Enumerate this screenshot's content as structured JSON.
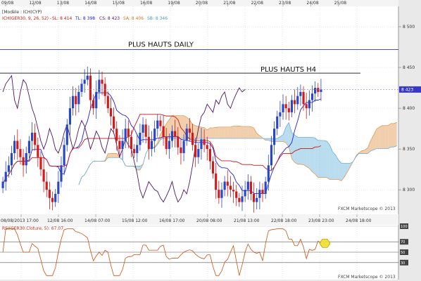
{
  "header": {
    "modele": "[Modèle : ICH(CYP)",
    "ichimoku_name": "ICH(GER30, 9, 26, 52) -",
    "sl": "SL: 8 414",
    "tl": "TL: 8 398",
    "cs": "CS: 8 423",
    "sa": "SA: 8 406",
    "sb": "SB: 8 346"
  },
  "top_dates": [
    "09/08",
    "12/08",
    "13/08",
    "14/08",
    "15/08",
    "16/08",
    "19/08",
    "20/08",
    "21/08",
    "22/08",
    "23/08",
    "24/08",
    "25/08"
  ],
  "bottom_dates": [
    "08/08/2013 17:00",
    "12/08 16:00",
    "14/08 07:00",
    "15/08 12:00",
    "16/08 17:00",
    "20/08 08:00",
    "21/08 13:00",
    "22/08 18:00",
    "23/08 23:00",
    "24/08 18:00"
  ],
  "price_axis": {
    "ticks": [
      "8 500",
      "8 450",
      "8 400",
      "8 350",
      "8 300"
    ],
    "current": "8 423"
  },
  "annotations": {
    "daily": "PLUS HAUTS DAILY",
    "h4": "PLUS HAUTS H4"
  },
  "watermark": "FXCM Marketscope © 2013",
  "rsi": {
    "label": "RSI(GER30.Cloture, 5): 67.07",
    "ticks": [
      "100",
      "70",
      "50",
      "30"
    ]
  },
  "colors": {
    "bull": "#2746c8",
    "bear": "#d21a1a",
    "tenkan": "#2020d8",
    "kijun": "#c81818",
    "chikou": "#4a1860",
    "senkou_a": "#e8a868",
    "senkou_b": "#80c0e0",
    "rsi": "#d05010",
    "highlight": "#f0e040"
  },
  "chart_data": [
    {
      "type": "candlestick",
      "title": "",
      "ylim": [
        8270,
        8525
      ],
      "x_ticks": [
        "08/08/2013 17:00",
        "12/08 16:00",
        "14/08 07:00",
        "15/08 12:00",
        "16/08 17:00",
        "20/08 08:00",
        "21/08 13:00",
        "22/08 18:00",
        "23/08 23:00",
        "24/08 18:00"
      ],
      "levels": [
        {
          "name": "PLUS HAUTS DAILY",
          "value": 8472
        },
        {
          "name": "PLUS HAUTS H4",
          "value": 8443
        }
      ],
      "closes": [
        8310,
        8322,
        8330,
        8345,
        8360,
        8350,
        8340,
        8330,
        8345,
        8360,
        8370,
        8355,
        8340,
        8325,
        8310,
        8300,
        8290,
        8285,
        8295,
        8310,
        8330,
        8355,
        8380,
        8400,
        8415,
        8405,
        8420,
        8430,
        8435,
        8440,
        8410,
        8400,
        8420,
        8435,
        8430,
        8415,
        8400,
        8390,
        8375,
        8360,
        8350,
        8360,
        8375,
        8365,
        8350,
        8345,
        8355,
        8370,
        8380,
        8365,
        8350,
        8360,
        8375,
        8385,
        8378,
        8365,
        8350,
        8360,
        8372,
        8365,
        8352,
        8345,
        8360,
        8375,
        8370,
        8355,
        8340,
        8350,
        8362,
        8355,
        8350,
        8335,
        8320,
        8300,
        8290,
        8300,
        8310,
        8305,
        8300,
        8298,
        8290,
        8285,
        8292,
        8300,
        8310,
        8295,
        8285,
        8290,
        8300,
        8295,
        8310,
        8330,
        8355,
        8375,
        8390,
        8395,
        8405,
        8400,
        8395,
        8410,
        8405,
        8415,
        8420,
        8405,
        8400,
        8410,
        8418,
        8425,
        8420,
        8423
      ],
      "series": [
        {
          "name": "SL",
          "last": 8414
        },
        {
          "name": "TL",
          "last": 8398
        },
        {
          "name": "CS",
          "last": 8423
        },
        {
          "name": "SA",
          "last": 8406
        },
        {
          "name": "SB",
          "last": 8346
        }
      ]
    },
    {
      "type": "line",
      "title": "RSI(GER30.Cloture, 5): 67.07",
      "ylim": [
        0,
        100
      ],
      "y_ticks": [
        100,
        70,
        50,
        30
      ],
      "last": 67.07
    }
  ]
}
